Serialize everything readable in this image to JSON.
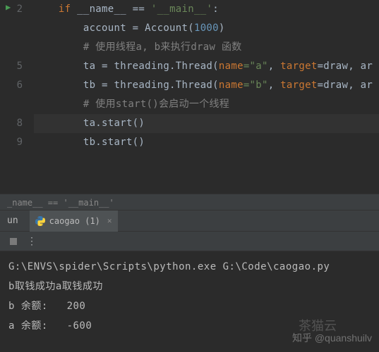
{
  "gutter": [
    "2",
    "",
    "",
    "5",
    "6",
    "",
    "8",
    "9"
  ],
  "code": {
    "line1": {
      "indent": "    ",
      "kw": "if",
      "name": " __name__ ",
      "op": "==",
      "str": " '__main__'",
      ":": ":"
    },
    "line2": {
      "indent": "        ",
      "text": "account = Account(",
      "num": "1000",
      "end": ")"
    },
    "line3": {
      "indent": "        ",
      "comment": "# 使用线程a, b来执行draw 函数"
    },
    "line4": {
      "indent": "        ",
      "text": "ta = threading.Thread(",
      "p1": "name",
      "v1": "=\"a\"",
      "c": ", ",
      "p2": "target",
      "v2": "=draw, ar"
    },
    "line5": {
      "indent": "        ",
      "text": "tb = threading.Thread(",
      "p1": "name",
      "v1": "=\"b\"",
      "c": ", ",
      "p2": "target",
      "v2": "=draw, ar"
    },
    "line6": {
      "indent": "        ",
      "comment": "# 使用start()会启动一个线程"
    },
    "line7": {
      "indent": "        ",
      "text": "ta.start()"
    },
    "line8": {
      "indent": "        ",
      "text": "tb.start()"
    }
  },
  "breadcrumb": "_name__ == '__main__'",
  "run_label": "un",
  "tab_name": "caogao (1)",
  "console": {
    "line1": "G:\\ENVS\\spider\\Scripts\\python.exe G:\\Code\\caogao.py",
    "line2": "b取钱成功a取钱成功",
    "line3": "b 余额:   200",
    "line4": "",
    "line5": "a 余额:   -600"
  },
  "watermark": "知乎 @quanshuilv",
  "watermark2": "茶猫云"
}
